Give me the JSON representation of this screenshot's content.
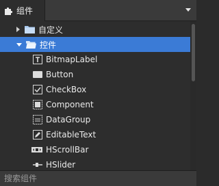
{
  "header": {
    "tab_label": "组件",
    "tab_icon": "puzzle-icon",
    "menu_icon": "caret-down-icon"
  },
  "tree": {
    "custom_folder": {
      "label": "自定义",
      "expanded": false
    },
    "controls_folder": {
      "label": "控件",
      "expanded": true,
      "selected": true
    },
    "items": [
      {
        "label": "BitmapLabel",
        "icon": "bitmaplabel-icon"
      },
      {
        "label": "Button",
        "icon": "button-icon"
      },
      {
        "label": "CheckBox",
        "icon": "checkbox-icon"
      },
      {
        "label": "Component",
        "icon": "component-icon"
      },
      {
        "label": "DataGroup",
        "icon": "datagroup-icon"
      },
      {
        "label": "EditableText",
        "icon": "editabletext-icon"
      },
      {
        "label": "HScrollBar",
        "icon": "hscrollbar-icon"
      },
      {
        "label": "HSlider",
        "icon": "hslider-icon"
      }
    ]
  },
  "search": {
    "placeholder": "搜索组件",
    "value": ""
  },
  "colors": {
    "selection": "#3b7bd6",
    "panel": "#2d2d2d",
    "header": "#3a3a3a"
  }
}
